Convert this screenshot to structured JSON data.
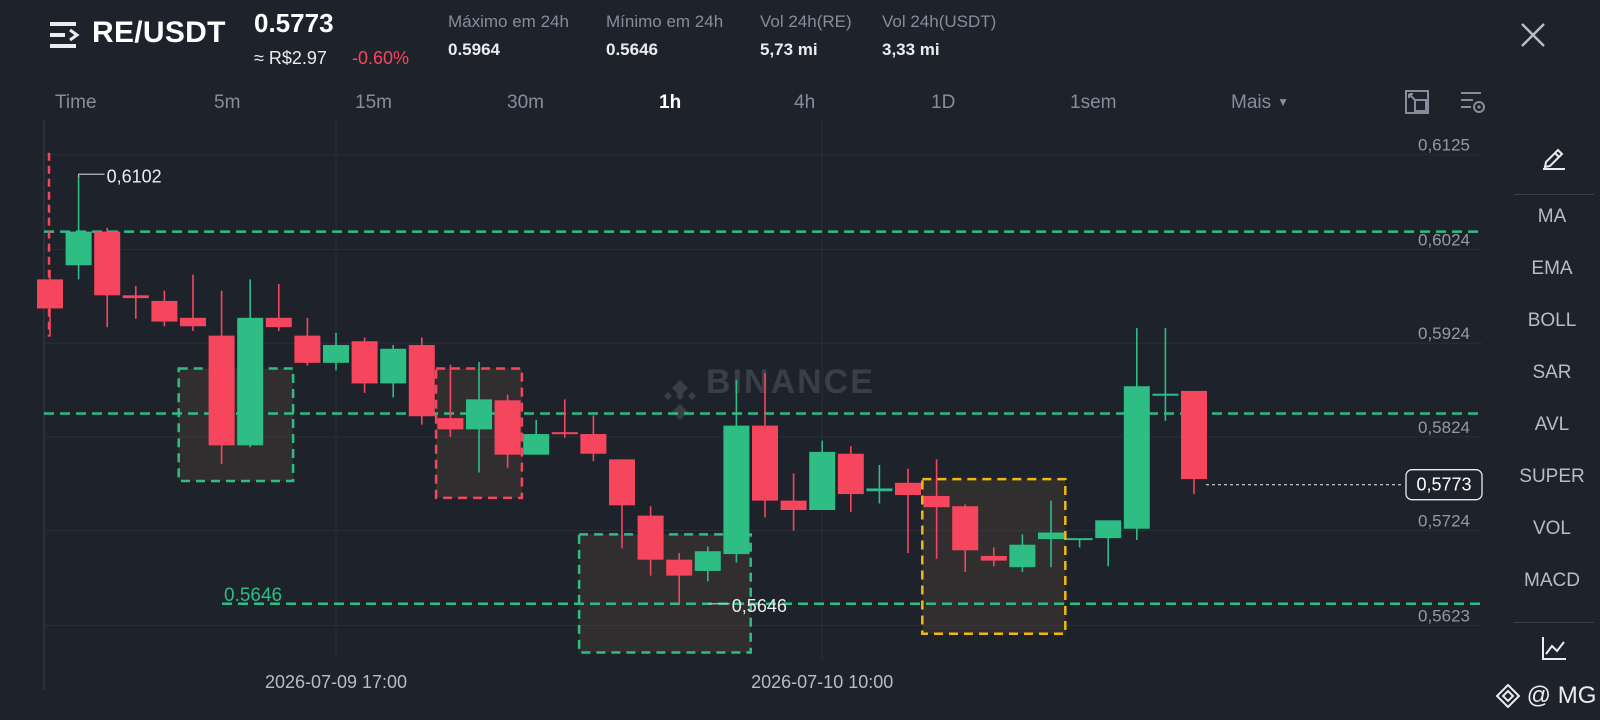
{
  "header": {
    "pair": "RE/USDT",
    "last_price": "0.5773",
    "approx_price": "≈ R$2.97",
    "change_pct": "-0.60%",
    "stats": [
      {
        "label": "Máximo em 24h",
        "value": "0.5964"
      },
      {
        "label": "Mínimo em 24h",
        "value": "0.5646"
      },
      {
        "label": "Vol 24h(RE)",
        "value": "5,73 mi"
      },
      {
        "label": "Vol 24h(USDT)",
        "value": "3,33 mi"
      }
    ]
  },
  "timeframes": {
    "items": [
      "Time",
      "5m",
      "15m",
      "30m",
      "1h",
      "4h",
      "1D",
      "1sem"
    ],
    "active": "1h",
    "more": "Mais"
  },
  "sidebar": {
    "indicators": [
      "MA",
      "EMA",
      "BOLL",
      "SAR",
      "AVL",
      "SUPER",
      "VOL",
      "MACD"
    ]
  },
  "watermark": "BINANCE",
  "footer_tag": "@ MG",
  "colors": {
    "up": "#2ebd85",
    "down": "#f6465d",
    "background": "#1e222b",
    "grid": "#2a2f38",
    "support_line": "#2ebd85",
    "highlight_box": "#f0b90b"
  },
  "chart_data": {
    "type": "candlestick",
    "y_ticks": [
      "0,6125",
      "0,6024",
      "0,5924",
      "0,5824",
      "0,5724",
      "0,5623"
    ],
    "ylim": [
      0.5586,
      0.6162
    ],
    "x_labels": [
      {
        "text": "2026-07-09 17:00",
        "index": 10
      },
      {
        "text": "2026-07-10 10:00",
        "index": 27
      }
    ],
    "current_price": {
      "label": "0,5773",
      "value": 0.5773
    },
    "high_marker": {
      "label": "0,6102",
      "value": 0.6102,
      "index": 1
    },
    "low_marker": {
      "label": "0,5646",
      "value": 0.5646,
      "index": 23
    },
    "support_label": "0.5646",
    "horizontal_lines": [
      0.6043,
      0.5849,
      0.5646
    ],
    "candles": [
      {
        "o": 0.5992,
        "h": 0.6002,
        "l": 0.5931,
        "c": 0.5961
      },
      {
        "o": 0.6007,
        "h": 0.6102,
        "l": 0.5992,
        "c": 0.6043
      },
      {
        "o": 0.6043,
        "h": 0.6047,
        "l": 0.5941,
        "c": 0.5975
      },
      {
        "o": 0.5975,
        "h": 0.5985,
        "l": 0.595,
        "c": 0.5972
      },
      {
        "o": 0.5969,
        "h": 0.598,
        "l": 0.5942,
        "c": 0.5947
      },
      {
        "o": 0.5951,
        "h": 0.5997,
        "l": 0.5937,
        "c": 0.5942
      },
      {
        "o": 0.5932,
        "h": 0.598,
        "l": 0.5795,
        "c": 0.5815
      },
      {
        "o": 0.5815,
        "h": 0.5992,
        "l": 0.5813,
        "c": 0.5951
      },
      {
        "o": 0.5951,
        "h": 0.5987,
        "l": 0.5937,
        "c": 0.5941
      },
      {
        "o": 0.5932,
        "h": 0.5951,
        "l": 0.59,
        "c": 0.5903
      },
      {
        "o": 0.5903,
        "h": 0.5935,
        "l": 0.5895,
        "c": 0.5922
      },
      {
        "o": 0.5926,
        "h": 0.593,
        "l": 0.5871,
        "c": 0.5881
      },
      {
        "o": 0.5881,
        "h": 0.5922,
        "l": 0.5866,
        "c": 0.5918
      },
      {
        "o": 0.5922,
        "h": 0.593,
        "l": 0.5837,
        "c": 0.5846
      },
      {
        "o": 0.5844,
        "h": 0.5901,
        "l": 0.5824,
        "c": 0.5832
      },
      {
        "o": 0.5832,
        "h": 0.5904,
        "l": 0.5786,
        "c": 0.5864
      },
      {
        "o": 0.5863,
        "h": 0.5869,
        "l": 0.5791,
        "c": 0.5805
      },
      {
        "o": 0.5805,
        "h": 0.5842,
        "l": 0.5805,
        "c": 0.5827
      },
      {
        "o": 0.5829,
        "h": 0.5864,
        "l": 0.5823,
        "c": 0.5827
      },
      {
        "o": 0.5827,
        "h": 0.5847,
        "l": 0.5798,
        "c": 0.5806
      },
      {
        "o": 0.58,
        "h": 0.58,
        "l": 0.5705,
        "c": 0.5751
      },
      {
        "o": 0.574,
        "h": 0.575,
        "l": 0.5676,
        "c": 0.5693
      },
      {
        "o": 0.5693,
        "h": 0.57,
        "l": 0.5646,
        "c": 0.5676
      },
      {
        "o": 0.5681,
        "h": 0.5707,
        "l": 0.567,
        "c": 0.5702
      },
      {
        "o": 0.5699,
        "h": 0.5885,
        "l": 0.569,
        "c": 0.5836
      },
      {
        "o": 0.5836,
        "h": 0.5892,
        "l": 0.5738,
        "c": 0.5756
      },
      {
        "o": 0.5756,
        "h": 0.5785,
        "l": 0.5724,
        "c": 0.5746
      },
      {
        "o": 0.5746,
        "h": 0.582,
        "l": 0.5746,
        "c": 0.5808
      },
      {
        "o": 0.5806,
        "h": 0.5814,
        "l": 0.5744,
        "c": 0.5763
      },
      {
        "o": 0.5766,
        "h": 0.5794,
        "l": 0.5753,
        "c": 0.5769
      },
      {
        "o": 0.5775,
        "h": 0.579,
        "l": 0.57,
        "c": 0.5762
      },
      {
        "o": 0.5761,
        "h": 0.58,
        "l": 0.5694,
        "c": 0.5749
      },
      {
        "o": 0.575,
        "h": 0.5752,
        "l": 0.568,
        "c": 0.5703
      },
      {
        "o": 0.5697,
        "h": 0.5706,
        "l": 0.5686,
        "c": 0.5692
      },
      {
        "o": 0.5685,
        "h": 0.572,
        "l": 0.568,
        "c": 0.5709
      },
      {
        "o": 0.5715,
        "h": 0.5756,
        "l": 0.5685,
        "c": 0.5722
      },
      {
        "o": 0.5716,
        "h": 0.5716,
        "l": 0.5706,
        "c": 0.5716
      },
      {
        "o": 0.5716,
        "h": 0.573,
        "l": 0.5686,
        "c": 0.5735
      },
      {
        "o": 0.5726,
        "h": 0.594,
        "l": 0.5714,
        "c": 0.5878
      },
      {
        "o": 0.587,
        "h": 0.594,
        "l": 0.5841,
        "c": 0.587
      },
      {
        "o": 0.5873,
        "h": 0.5873,
        "l": 0.5763,
        "c": 0.5779
      }
    ],
    "boxes": [
      {
        "type": "green",
        "from": 4.5,
        "to": 8.5,
        "top": 0.5897,
        "bottom": 0.5777
      },
      {
        "type": "red",
        "from": 13.5,
        "to": 16.5,
        "top": 0.5897,
        "bottom": 0.5759
      },
      {
        "type": "green",
        "from": 18.5,
        "to": 24.5,
        "top": 0.572,
        "bottom": 0.5594
      },
      {
        "type": "yellow",
        "from": 30.5,
        "to": 35.5,
        "top": 0.5779,
        "bottom": 0.5614
      }
    ]
  }
}
